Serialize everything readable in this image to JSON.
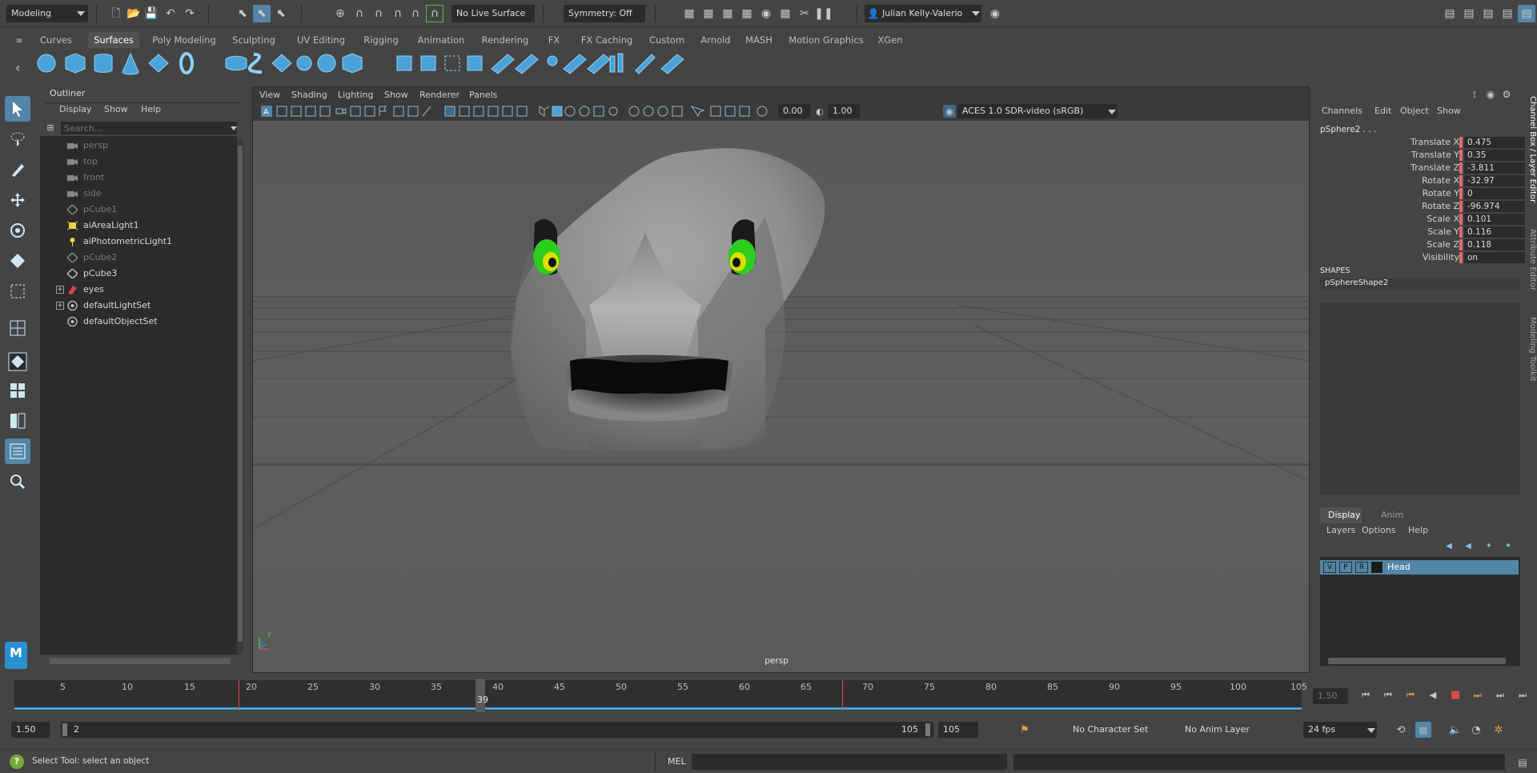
{
  "top": {
    "workspace": "Modeling",
    "live_surface": "No Live Surface",
    "symmetry": "Symmetry: Off",
    "user": "Julian Kelly-Valerio"
  },
  "shelf_tabs": [
    "Curves",
    "Surfaces",
    "Poly Modeling",
    "Sculpting",
    "UV Editing",
    "Rigging",
    "Animation",
    "Rendering",
    "FX",
    "FX Caching",
    "Custom",
    "Arnold",
    "MASH",
    "Motion Graphics",
    "XGen"
  ],
  "shelf_active": "Surfaces",
  "outliner": {
    "title": "Outliner",
    "menu": [
      "Display",
      "Show",
      "Help"
    ],
    "search_placeholder": "Search...",
    "items": [
      {
        "label": "persp",
        "icon": "camera-icon",
        "dim": true
      },
      {
        "label": "top",
        "icon": "camera-icon",
        "dim": true
      },
      {
        "label": "front",
        "icon": "camera-icon",
        "dim": true
      },
      {
        "label": "side",
        "icon": "camera-icon",
        "dim": true
      },
      {
        "label": "pCube1",
        "icon": "mesh-icon",
        "dim": true
      },
      {
        "label": "aiAreaLight1",
        "icon": "area-light-icon",
        "dim": false
      },
      {
        "label": "aiPhotometricLight1",
        "icon": "photometric-light-icon",
        "dim": false
      },
      {
        "label": "pCube2",
        "icon": "mesh-icon",
        "dim": true
      },
      {
        "label": "pCube3",
        "icon": "mesh-icon",
        "dim": false
      },
      {
        "label": "eyes",
        "icon": "group-icon",
        "dim": false,
        "expandable": true
      },
      {
        "label": "defaultLightSet",
        "icon": "set-icon",
        "dim": false,
        "expandable": true
      },
      {
        "label": "defaultObjectSet",
        "icon": "set-icon",
        "dim": false
      }
    ]
  },
  "viewport": {
    "menu": [
      "View",
      "Shading",
      "Lighting",
      "Show",
      "Renderer",
      "Panels"
    ],
    "exposure": "0.00",
    "gamma": "1.00",
    "color_space": "ACES 1.0 SDR-video (sRGB)",
    "camera_label": "persp",
    "axis_y": "y",
    "axis_z": "z"
  },
  "channel_box": {
    "menu": [
      "Channels",
      "Edit",
      "Object",
      "Show"
    ],
    "object": "pSphere2 . . .",
    "attributes": [
      {
        "label": "Translate X",
        "value": "0.475"
      },
      {
        "label": "Translate Y",
        "value": "0.35"
      },
      {
        "label": "Translate Z",
        "value": "-3.811"
      },
      {
        "label": "Rotate X",
        "value": "-32.97"
      },
      {
        "label": "Rotate Y",
        "value": "0"
      },
      {
        "label": "Rotate Z",
        "value": "-96.974"
      },
      {
        "label": "Scale X",
        "value": "0.101"
      },
      {
        "label": "Scale Y",
        "value": "0.116"
      },
      {
        "label": "Scale Z",
        "value": "0.118"
      },
      {
        "label": "Visibility",
        "value": "on"
      }
    ],
    "shapes_header": "SHAPES",
    "shape_name": "pSphereShape2"
  },
  "side_tabs": [
    "Channel Box / Layer Editor",
    "Attribute Editor",
    "Modeling Toolkit"
  ],
  "layer_editor": {
    "tabs": [
      "Display",
      "Anim"
    ],
    "menu": [
      "Layers",
      "Options",
      "Help"
    ],
    "layer": {
      "v": "V",
      "p": "P",
      "r": "R",
      "name": "Head"
    }
  },
  "timeline": {
    "ticks": [
      "5",
      "10",
      "15",
      "20",
      "25",
      "30",
      "35",
      "40",
      "45",
      "50",
      "55",
      "60",
      "65",
      "70",
      "75",
      "80",
      "85",
      "90",
      "95",
      "100",
      "105"
    ],
    "current_frame": "39",
    "current_time_field": "1.50"
  },
  "range": {
    "start": "1.50",
    "inner_start": "2",
    "inner_end": "105",
    "end": "105",
    "character_set": "No Character Set",
    "anim_layer": "No Anim Layer",
    "fps": "24 fps"
  },
  "status": {
    "help_text": "Select Tool: select an object",
    "command_lang": "MEL"
  },
  "colors": {
    "accent": "#5285a6",
    "keyframe_marker": "#e04848",
    "head_mesh": "#8e8e8e",
    "eye_outer": "#2ecc1f",
    "eye_inner": "#d9e000"
  }
}
